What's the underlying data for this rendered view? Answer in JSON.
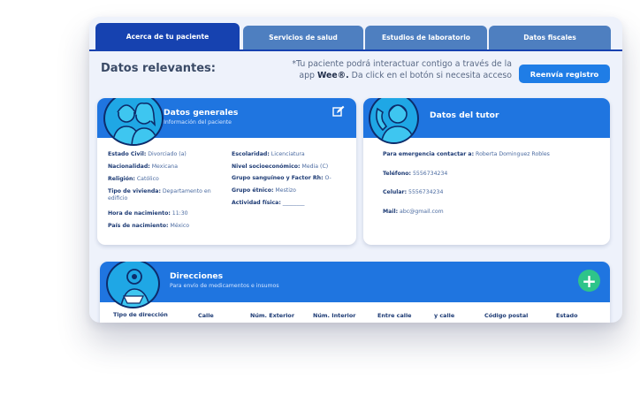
{
  "tabs": [
    {
      "label": "Acerca de tu paciente"
    },
    {
      "label": "Servicios de salud"
    },
    {
      "label": "Estudios de laboratorio"
    },
    {
      "label": "Datos fiscales"
    }
  ],
  "header": {
    "title": "Datos relevantes:",
    "notice_line1": "*Tu paciente podrá  interactuar contigo a través de la",
    "notice_app_prefix": "app ",
    "notice_app_name": "Wee®.",
    "notice_line2_rest": "  Da click en el botón si necesita acceso",
    "resend_label": "Reenvía registro"
  },
  "general": {
    "title": "Datos generales",
    "subtitle": "Información del paciente",
    "left": [
      {
        "label": "Estado Civil:",
        "value": " Divorciado (a)"
      },
      {
        "label": "Nacionalidad:",
        "value": " Mexicana"
      },
      {
        "label": "Religión:",
        "value": " Católico"
      },
      {
        "label": "Tipo de vivienda:",
        "value": " Departamento en edificio"
      },
      {
        "label": "Hora de nacimiento:",
        "value": " 11:30"
      },
      {
        "label": "País de nacimiento:",
        "value": " México"
      }
    ],
    "right": [
      {
        "label": "Escolaridad:",
        "value": " Licenciatura"
      },
      {
        "label": "Nivel socioeconómico:",
        "value": "  Media (C)"
      },
      {
        "label": "Grupo sanguíneo y Factor Rh:",
        "value": " O-"
      },
      {
        "label": "Grupo étnico:",
        "value": " Mestizo"
      },
      {
        "label": "Actividad física:",
        "value": " ________"
      }
    ]
  },
  "tutor": {
    "title": "Datos del tutor",
    "fields": [
      {
        "label": "Para emergencia contactar a:",
        "value": "  Roberta Dominguez Robles"
      },
      {
        "label": "Teléfono:",
        "value": " 5556734234"
      },
      {
        "label": "Celular:",
        "value": " 5556734234"
      },
      {
        "label": "Mail:",
        "value": " abc@gmail.com"
      }
    ]
  },
  "addresses": {
    "title": "Direcciones",
    "subtitle": "Para envío de medicamentos e insumos",
    "add_icon": "+",
    "columns": [
      "Tipo de dirección",
      "Calle",
      "Núm. Exterior",
      "Núm. Interior",
      "Entre calle",
      "y calle",
      "Código postal",
      "Estado"
    ]
  },
  "colors": {
    "primary": "#1f75e0",
    "tab_active": "#1642b0",
    "tab": "#4e7fc0",
    "add": "#2ec48a"
  }
}
